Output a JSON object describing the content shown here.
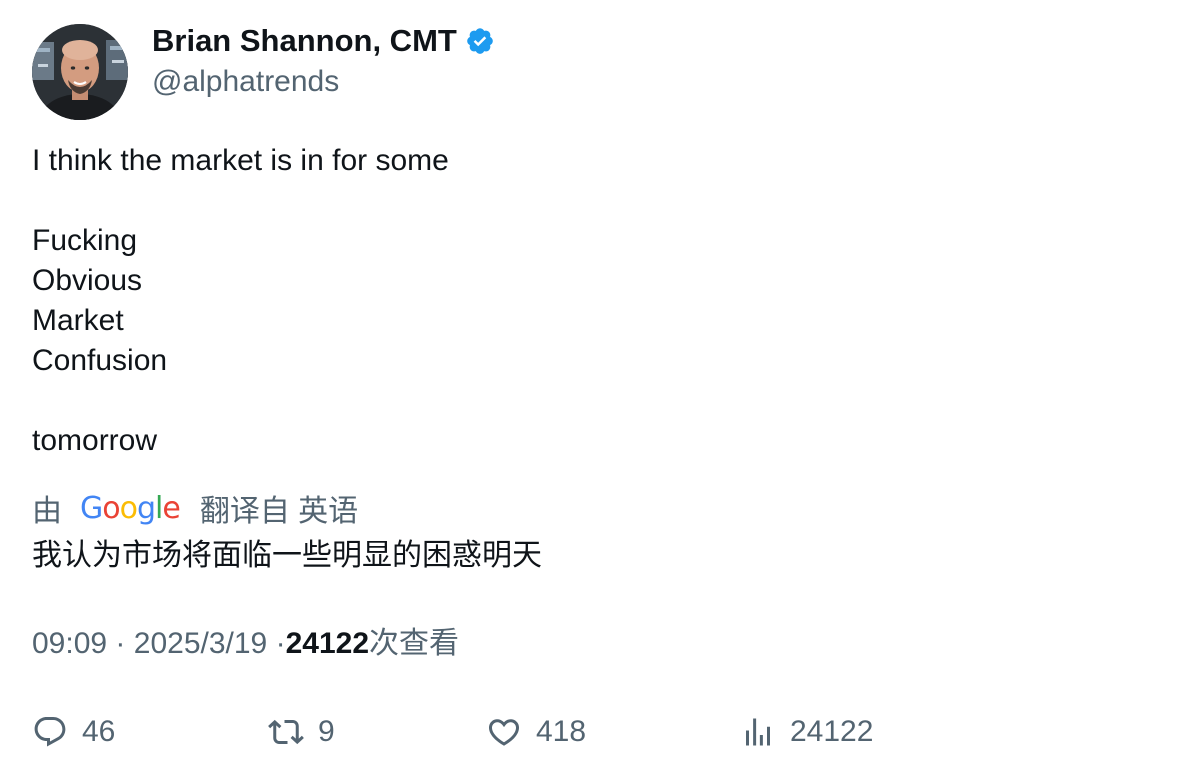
{
  "author": {
    "name": "Brian Shannon, CMT",
    "handle": "@alphatrends",
    "verified": true
  },
  "tweet": {
    "lines": [
      "I think the market is in for some",
      "",
      "Fucking",
      "Obvious",
      "Market",
      "Confusion",
      "",
      "tomorrow"
    ]
  },
  "translation": {
    "by_label": "由",
    "provider": "Google",
    "from_label": "翻译自 英语",
    "text": "我认为市场将面临一些明显的困惑明天"
  },
  "meta": {
    "time": "09:09",
    "separator": "·",
    "date": "2025/3/19",
    "views_count": "24122",
    "views_label": "次查看"
  },
  "actions": {
    "replies": "46",
    "retweets": "9",
    "likes": "418",
    "views": "24122"
  },
  "colors": {
    "text_primary": "#0f1419",
    "text_secondary": "#536471",
    "verified_blue": "#1d9bf0"
  }
}
